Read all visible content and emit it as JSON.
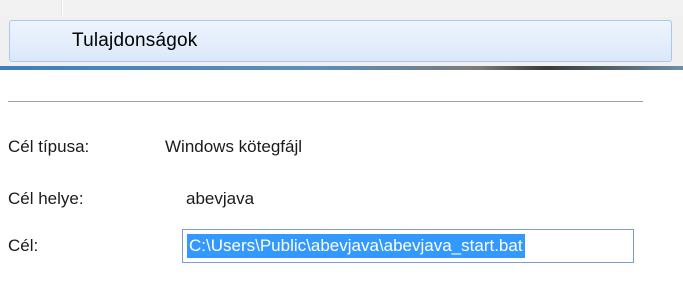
{
  "context_menu": {
    "properties_item_label": "Tulajdonságok"
  },
  "properties": {
    "target_type": {
      "label": "Cél típusa:",
      "value": "Windows kötegfájl"
    },
    "target_location": {
      "label": "Cél helye:",
      "value": "abevjava"
    },
    "target": {
      "label": "Cél:",
      "value": "C:\\Users\\Public\\abevjava\\abevjava_start.bat"
    }
  },
  "colors": {
    "selection_background": "#3399ff",
    "menu_highlight_border": "#aac7ee",
    "field_border": "#7a9cd3"
  }
}
